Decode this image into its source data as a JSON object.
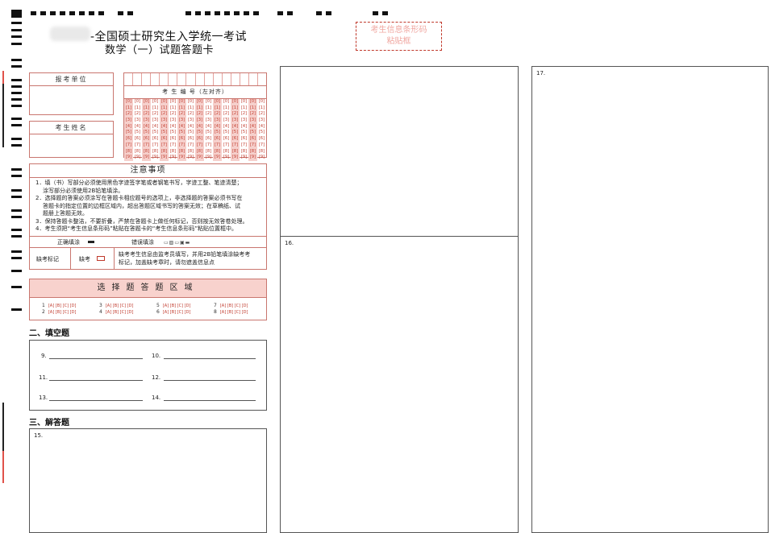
{
  "header": {
    "title_line1": "-全国硕士研究生入学统一考试",
    "title_line2": "数学（一）试题答题卡",
    "barcode_label_line1": "考生信息条形码",
    "barcode_label_line2": "粘贴框"
  },
  "applicant": {
    "unit_label": "报考单位",
    "name_label": "考生姓名"
  },
  "exam_number": {
    "label": "考 生 编 号（左对齐）",
    "digits": [
      "[0]",
      "[1]",
      "[2]",
      "[3]",
      "[4]",
      "[5]",
      "[6]",
      "[7]",
      "[8]",
      "[9]"
    ]
  },
  "notes": {
    "title": "注意事项",
    "items": [
      "1．填（书）写部分必须使用黑色字迹签字笔或者钢笔书写，字迹工整、笔迹清楚；",
      "涂写部分必须使用2B铅笔填涂。",
      "2．选择题的答案必须涂写在答题卡相应题号的选项上，非选择题的答案必须书写在",
      "答题卡的指定位置的边框区域内，超出答题区域书写的答案无效；在草稿纸、试",
      "题册上答题无效。",
      "3．保持答题卡整洁，不要折叠，严禁在答题卡上做任何标记，否则按无效答卷处理。",
      "4．考生须把“考生信息条形码”粘贴在答题卡的“考生信息条形码”粘贴位置框中。"
    ],
    "correct_fill": "正确填涂",
    "wrong_fill": "错误填涂",
    "absent_mark": "缺考标记",
    "absent": "缺考",
    "absent_note_line1": "缺考考生信息由监考员填写，并用2B铅笔填涂缺考考",
    "absent_note_line2": "标记，加盖缺考章时，请勿遮盖信息点"
  },
  "mcq": {
    "title": "选择题答题区域",
    "options": "[A] [B] [C] [D]",
    "questions": [
      "1",
      "2",
      "3",
      "4",
      "5",
      "6",
      "7",
      "8"
    ]
  },
  "fill_blank": {
    "title": "二、填空题",
    "questions": [
      "9.",
      "10.",
      "11.",
      "12.",
      "13.",
      "14."
    ]
  },
  "solution": {
    "title": "三、解答题",
    "questions": [
      "15.",
      "16.",
      "17."
    ]
  }
}
